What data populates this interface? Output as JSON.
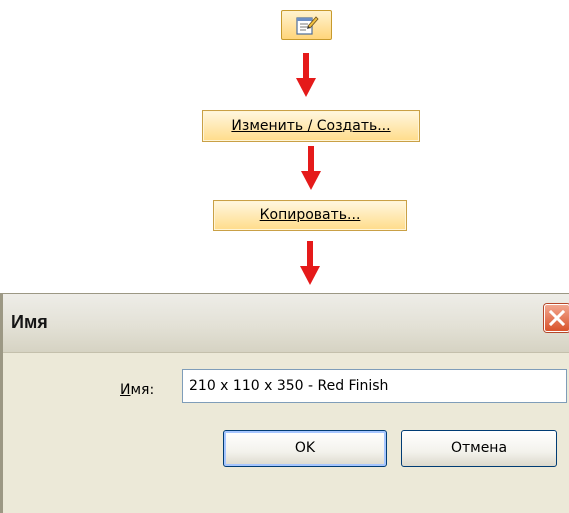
{
  "flow": {
    "properties_icon": "type-properties-icon",
    "edit_button_label": "Изменить / Создать...",
    "copy_button_label": "Копировать...",
    "arrow_color": "#e51a1a",
    "highlight_color": "#ffdc8a"
  },
  "dialog": {
    "title": "Имя",
    "close_icon": "close-icon",
    "name_label": "Имя:",
    "name_value": "210 x 110 x 350 - Red Finish",
    "ok_label": "OK",
    "cancel_label": "Отмена"
  }
}
